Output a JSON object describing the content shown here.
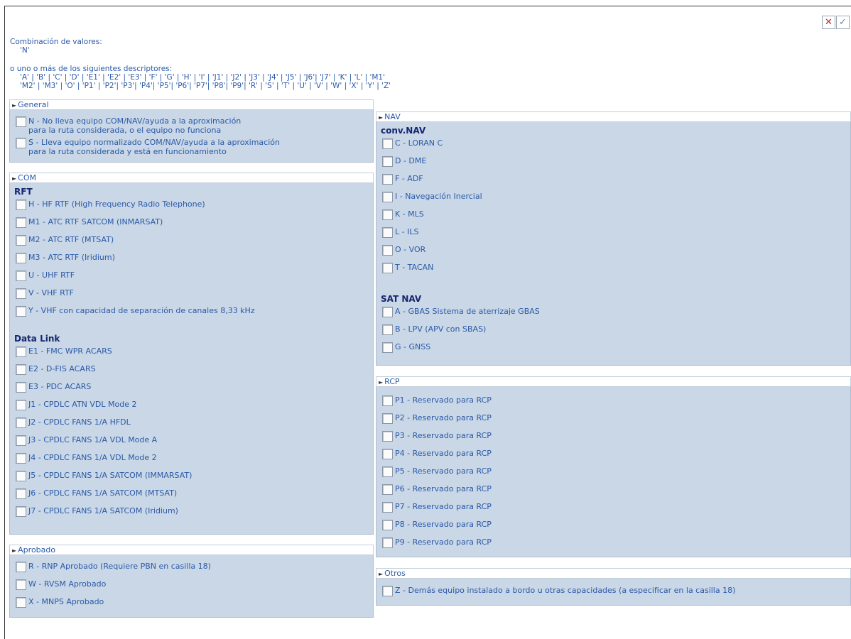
{
  "toolbar": {
    "close_label": "✕",
    "accept_label": "✓"
  },
  "intro": {
    "combo_title": "Combinación de valores:",
    "combo_value": "'N'",
    "or_text": "o uno o más de los siguientes descriptores:",
    "desc_line1": "'A' | 'B' | 'C' | 'D' | 'E1' | 'E2' | 'E3' | 'F' | 'G' | 'H' | 'I' | 'J1' | 'J2' | 'J3' | 'J4' | 'J5' | 'J6'| 'J7' | 'K' | 'L' | 'M1'",
    "desc_line2": "'M2' | 'M3' | 'O' | 'P1' | 'P2'| 'P3'| 'P4'| 'P5'| 'P6'| 'P7'| 'P8'| 'P9'| 'R' | 'S' | 'T' | 'U' | 'V' | 'W' | 'X' | 'Y' | 'Z'"
  },
  "sections": {
    "general": {
      "title": "General",
      "items": [
        "N - No lleva equipo COM/NAV/ayuda a la aproximación\n     para la ruta considerada, o el equipo no funciona",
        "S - Lleva equipo normalizado COM/NAV/ayuda a la aproximación\n     para la ruta considerada y está en funcionamiento"
      ]
    },
    "com": {
      "title": "COM",
      "rft_title": "RFT",
      "rft": [
        "H - HF RTF (High Frequency Radio Telephone)",
        "M1 - ATC RTF SATCOM (INMARSAT)",
        "M2 - ATC RTF (MTSAT)",
        "M3 - ATC RTF (Iridium)",
        "U - UHF RTF",
        "V - VHF RTF",
        "Y - VHF con capacidad de separación de canales 8,33 kHz"
      ],
      "dl_title": "Data Link",
      "dl": [
        "E1 - FMC WPR ACARS",
        "E2 - D-FIS ACARS",
        "E3 - PDC ACARS",
        "J1 - CPDLC ATN VDL Mode 2",
        "J2 - CPDLC FANS 1/A HFDL",
        "J3 - CPDLC FANS 1/A VDL Mode A",
        "J4 - CPDLC FANS 1/A VDL Mode 2",
        "J5 - CPDLC FANS 1/A SATCOM (IMMARSAT)",
        "J6 - CPDLC FANS 1/A SATCOM (MTSAT)",
        "J7 - CPDLC FANS 1/A SATCOM (Iridium)"
      ]
    },
    "aprobado": {
      "title": "Aprobado",
      "items": [
        "R - RNP Aprobado (Requiere PBN en casilla 18)",
        "W - RVSM Aprobado",
        "X - MNPS Aprobado"
      ]
    },
    "nav": {
      "title": "NAV",
      "conv_title": "conv.NAV",
      "conv": [
        "C - LORAN C",
        "D - DME",
        "F - ADF",
        "I - Navegación Inercial",
        "K - MLS",
        "L - ILS",
        "O - VOR",
        "T - TACAN"
      ],
      "sat_title": "SAT NAV",
      "sat": [
        "A - GBAS Sistema de aterrizaje GBAS",
        "B - LPV (APV con SBAS)",
        "G - GNSS"
      ]
    },
    "rcp": {
      "title": "RCP",
      "items": [
        "P1 - Reservado para RCP",
        "P2 - Reservado para RCP",
        "P3 - Reservado para RCP",
        "P4 - Reservado para RCP",
        "P5 - Reservado para RCP",
        "P6 - Reservado para RCP",
        "P7 - Reservado para RCP",
        "P8 - Reservado para RCP",
        "P9 - Reservado para RCP"
      ]
    },
    "otros": {
      "title": "Otros",
      "items": [
        "Z - Demás equipo instalado a bordo u otras capacidades (a especificar en la casilla 18)"
      ]
    }
  }
}
